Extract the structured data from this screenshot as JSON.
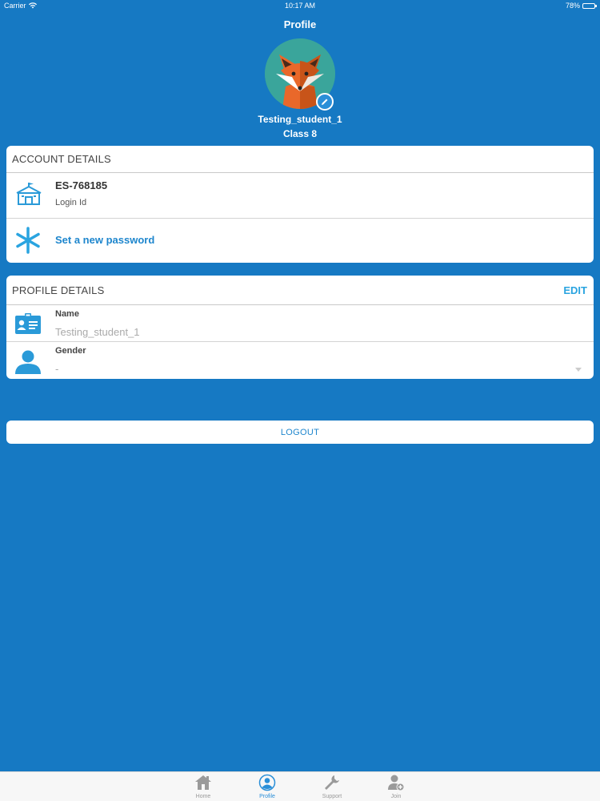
{
  "status_bar": {
    "carrier": "Carrier",
    "time": "10:17 AM",
    "battery": "78%",
    "battery_level": 0.78
  },
  "header": {
    "title": "Profile",
    "user_name": "Testing_student_1",
    "user_class": "Class 8"
  },
  "account_details": {
    "title": "ACCOUNT DETAILS",
    "login_id_value": "ES-768185",
    "login_id_label": "Login Id",
    "set_password_label": "Set a new password"
  },
  "profile_details": {
    "title": "PROFILE DETAILS",
    "edit_label": "EDIT",
    "name_label": "Name",
    "name_value": "Testing_student_1",
    "gender_label": "Gender",
    "gender_value": "-"
  },
  "logout_label": "LOGOUT",
  "tabs": [
    {
      "label": "Home",
      "icon": "home-icon",
      "active": false
    },
    {
      "label": "Profile",
      "icon": "profile-icon",
      "active": true
    },
    {
      "label": "Support",
      "icon": "wrench-icon",
      "active": false
    },
    {
      "label": "Join",
      "icon": "add-user-icon",
      "active": false
    }
  ],
  "colors": {
    "background": "#1679c3",
    "accent": "#2aa4e0",
    "link": "#1e86cd",
    "avatar_bg": "#3aa59b"
  }
}
